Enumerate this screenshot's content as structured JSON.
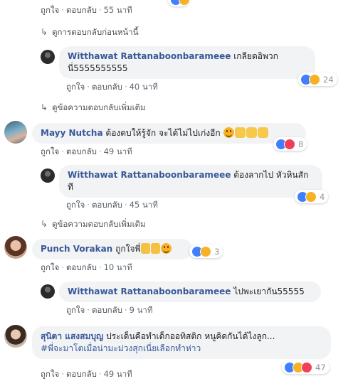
{
  "top_actions": {
    "like": "ถูกใจ",
    "reply": "ตอบกลับ",
    "time": "55 นาที"
  },
  "prev_replies_link": "ดูการตอบกลับก่อนหน้านี้",
  "comments": [
    {
      "author": "Witthawat Rattanaboonbarameee",
      "text_line1": "เกลียดอิพวก",
      "text_line2": "นี่5555555555",
      "like": "ถูกใจ",
      "reply": "ตอบกลับ",
      "time": "40 นาที",
      "reaction_count": "24"
    },
    {
      "more_link": "ดูข้อความตอบกลับเพิ่มเติม"
    },
    {
      "author": "Mayy Nutcha",
      "text": "ต้องตบให้รู้จัก จะได้ไม่ไปเก่งอีก",
      "like": "ถูกใจ",
      "reply": "ตอบกลับ",
      "time": "49 นาที",
      "reaction_count": "8"
    },
    {
      "author": "Witthawat Rattanaboonbarameee",
      "text_line1": "ต้องลากไป หัวหินสัก",
      "text_line2": "ที",
      "like": "ถูกใจ",
      "reply": "ตอบกลับ",
      "time": "45 นาที",
      "reaction_count": "4"
    },
    {
      "more_link": "ดูข้อความตอบกลับเพิ่มเติม"
    },
    {
      "author": "Punch Vorakan",
      "text": "ถูกใจพี่",
      "like": "ถูกใจ",
      "reply": "ตอบกลับ",
      "time": "10 นาที",
      "reaction_count": "3"
    },
    {
      "author": "Witthawat Rattanaboonbarameee",
      "text": "ไปพะเยากัน55555",
      "like": "ถูกใจ",
      "reply": "ตอบกลับ",
      "time": "9 นาที"
    },
    {
      "author": "สุนิตา แสงสมบุญ",
      "text": "ประเด็นคือทำเด็กออทิสติก หนูคิดกันได้ไงลูก...",
      "hashtag": "#พี่จะมาโตเมื่อน่ามะม่วงสุกเนี่ยเลือกทำห่าว",
      "like": "ถูกใจ",
      "reply": "ตอบกลับ",
      "time": "49 นาที",
      "reaction_count": "47"
    }
  ],
  "colors": {
    "link_blue": "#385898",
    "bubble_bg": "#f2f3f5",
    "meta_gray": "#606770",
    "like_blue": "#4080ff",
    "haha_yellow": "#f7b125",
    "love_red": "#f33e58"
  }
}
